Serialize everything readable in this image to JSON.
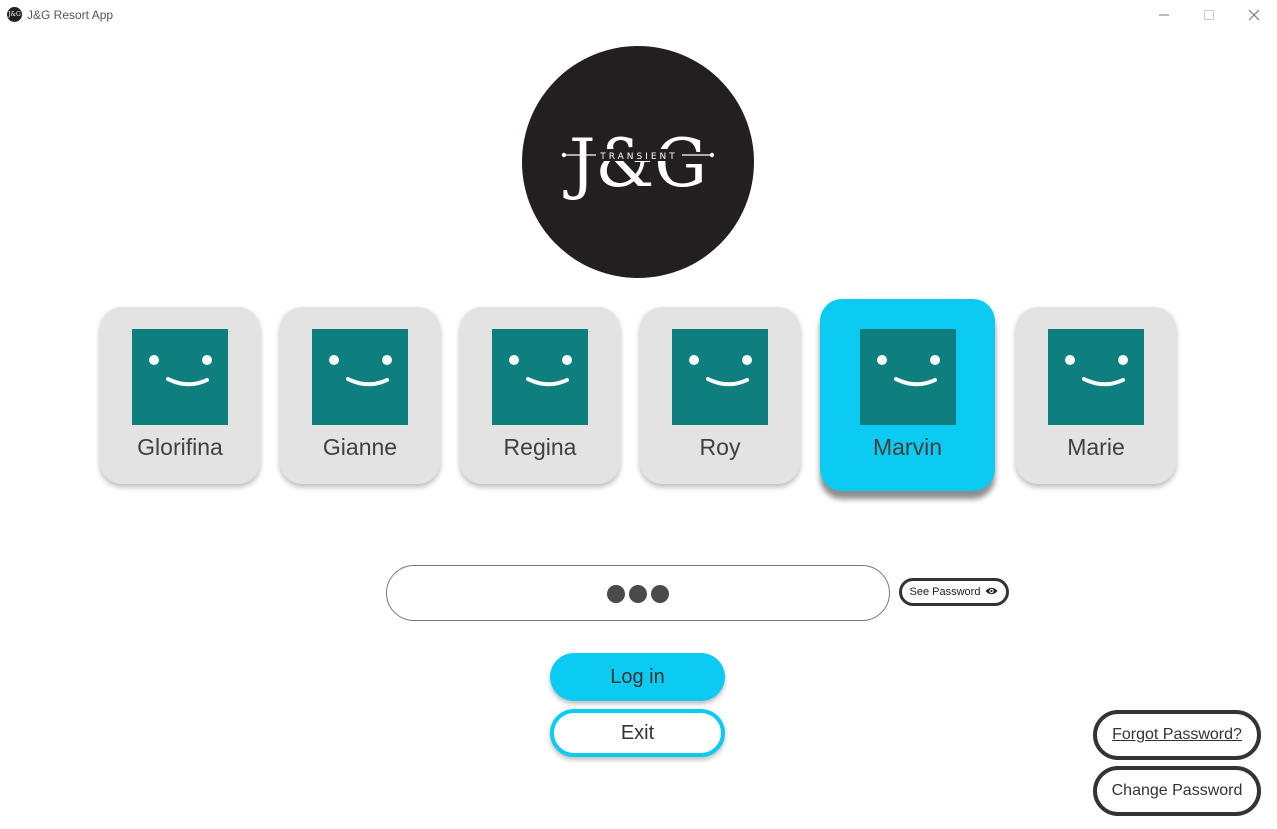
{
  "window": {
    "title": "J&G Resort App",
    "controls": [
      "minimize-icon",
      "maximize-icon",
      "close-icon"
    ]
  },
  "logo": {
    "main_text": "J&G",
    "sub_text": "TRANSIENT"
  },
  "users": [
    {
      "name": "Glorifina",
      "selected": false
    },
    {
      "name": "Gianne",
      "selected": false
    },
    {
      "name": "Regina",
      "selected": false
    },
    {
      "name": "Roy",
      "selected": false
    },
    {
      "name": "Marvin",
      "selected": true
    },
    {
      "name": "Marie",
      "selected": false
    }
  ],
  "password": {
    "masked_length": 3,
    "see_password_label": "See Password",
    "see_password_icon": "eye-icon"
  },
  "actions": {
    "login_label": "Log in",
    "exit_label": "Exit",
    "forgot_label": "Forgot Password?",
    "change_label": "Change Password"
  },
  "colors": {
    "accent": "#0ccbf2",
    "avatar": "#0e7e7e",
    "card": "#e3e3e3",
    "logo_bg": "#231f20"
  }
}
